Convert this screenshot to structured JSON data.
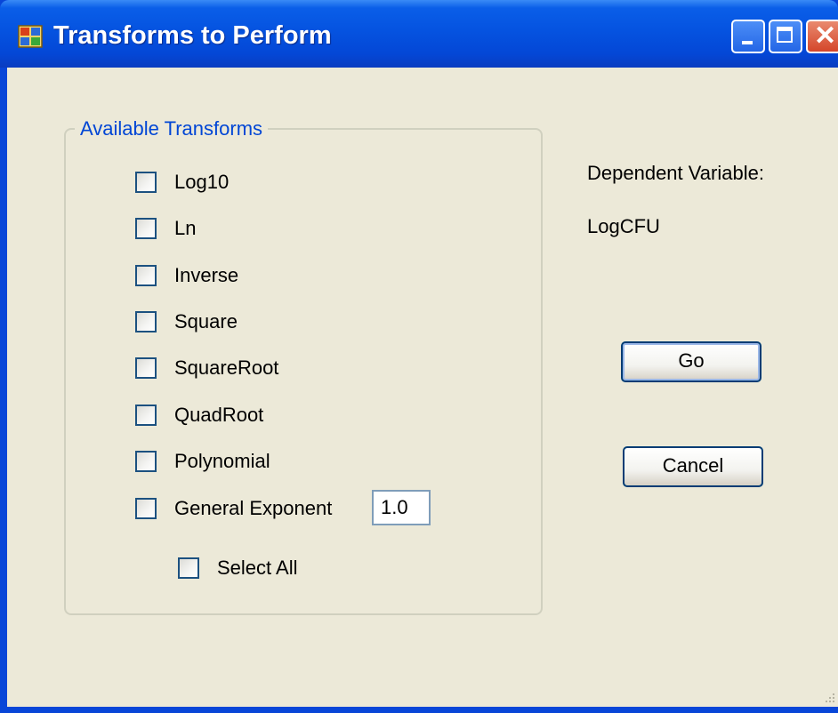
{
  "window": {
    "title": "Transforms to Perform"
  },
  "transforms_group": {
    "legend": "Available Transforms",
    "options": [
      {
        "label": "Log10",
        "checked": false
      },
      {
        "label": "Ln",
        "checked": false
      },
      {
        "label": "Inverse",
        "checked": false
      },
      {
        "label": "Square",
        "checked": false
      },
      {
        "label": "SquareRoot",
        "checked": false
      },
      {
        "label": "QuadRoot",
        "checked": false
      },
      {
        "label": "Polynomial",
        "checked": false
      },
      {
        "label": "General Exponent",
        "checked": false
      }
    ],
    "exponent_value": "1.0",
    "select_all": {
      "label": "Select All",
      "checked": false
    }
  },
  "dependent": {
    "label": "Dependent Variable:",
    "value": "LogCFU"
  },
  "buttons": {
    "go": "Go",
    "cancel": "Cancel"
  },
  "colors": {
    "title_bar": "#0553e0",
    "legend_text": "#0046d5",
    "dialog_background": "#ece9d8",
    "close_button": "#d4462a"
  }
}
